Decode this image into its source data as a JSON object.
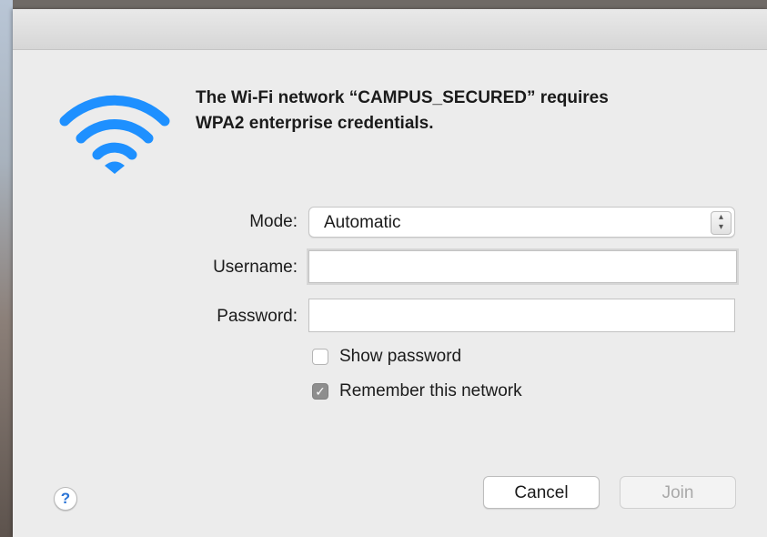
{
  "dialog": {
    "heading_line1": "The Wi-Fi network “CAMPUS_SECURED” requires",
    "heading_line2": "WPA2 enterprise credentials.",
    "icon": "wifi-icon",
    "accent_color": "#1e90ff"
  },
  "form": {
    "mode_label": "Mode:",
    "mode_value": "Automatic",
    "username_label": "Username:",
    "username_value": "",
    "password_label": "Password:",
    "password_value": ""
  },
  "options": {
    "show_password_label": "Show password",
    "show_password_checked": false,
    "remember_label": "Remember this network",
    "remember_checked": true
  },
  "buttons": {
    "help_label": "?",
    "cancel_label": "Cancel",
    "join_label": "Join",
    "join_enabled": false
  }
}
